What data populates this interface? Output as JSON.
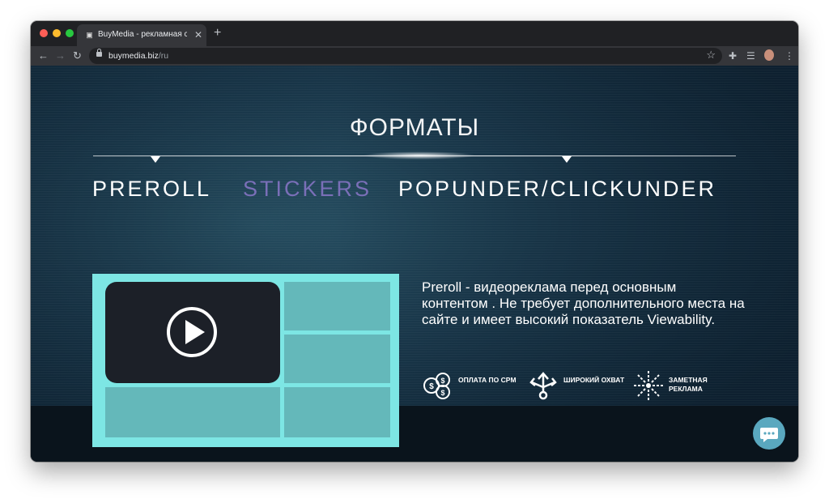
{
  "browser": {
    "tab_title": "BuyMedia - рекламная сеть д",
    "tab_close": "✕",
    "new_tab": "+",
    "url_host": "buymedia.biz",
    "url_path": "/ru",
    "back": "←",
    "forward": "→",
    "reload": "↻",
    "bookmark": "☆",
    "menu": "⋮"
  },
  "page": {
    "heading": "ФОРМАТЫ",
    "tabs": [
      {
        "label": "PREROLL",
        "color": "#ffffff"
      },
      {
        "label": "STICKERS",
        "color": "#7a6fb8"
      },
      {
        "label": "POPUNDER/CLICKUNDER",
        "color": "#ffffff"
      }
    ],
    "description": {
      "term": "Preroll",
      "text": " - видеореклама перед основным контентом . Не требует дополнительного места на сайте и имеет высокий показатель Viewability."
    },
    "features": [
      {
        "icon": "coins-dollar-icon",
        "label": "ОПЛАТА ПО CPM"
      },
      {
        "icon": "branching-arrows-icon",
        "label": "ШИРОКИЙ ОХВАТ"
      },
      {
        "icon": "burst-icon",
        "label": "ЗАМЕТНАЯ РЕКЛАМА"
      }
    ]
  },
  "colors": {
    "accent_teal": "#7de6e4",
    "cell_teal": "#64b8ba",
    "active_tab": "#7a6fb8",
    "chat": "#5aa8bf"
  }
}
